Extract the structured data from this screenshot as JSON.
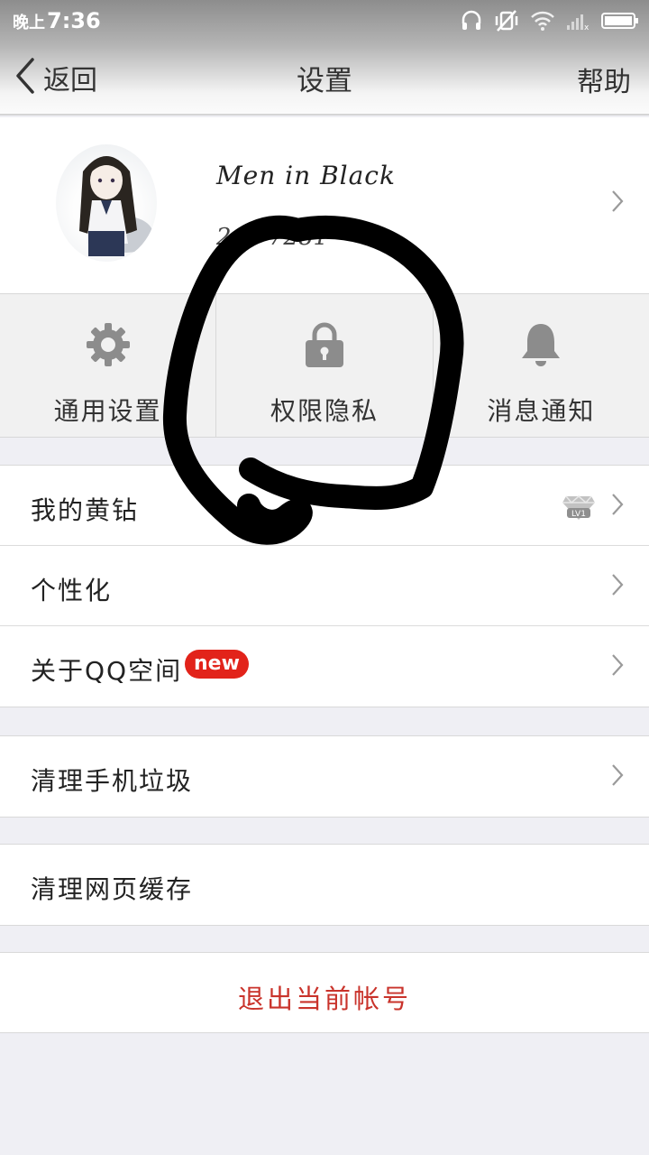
{
  "status_bar": {
    "period": "晚上",
    "time": "7:36",
    "icons": [
      "headset-icon",
      "vibrate-mute-icon",
      "wifi-icon",
      "signal-icon",
      "battery-icon"
    ]
  },
  "nav": {
    "back_label": "返回",
    "title": "设置",
    "help_label": "帮助"
  },
  "profile": {
    "name": "Men in Black",
    "number": "248  7281"
  },
  "quick_settings": [
    {
      "label": "通用设置",
      "icon": "gear-icon"
    },
    {
      "label": "权限隐私",
      "icon": "lock-icon"
    },
    {
      "label": "消息通知",
      "icon": "bell-icon"
    }
  ],
  "menu_group_1": [
    {
      "label": "我的黄钻",
      "badge": "LV1"
    },
    {
      "label": "个性化"
    },
    {
      "label": "关于QQ空间",
      "badge": "new"
    }
  ],
  "menu_group_2": [
    {
      "label": "清理手机垃圾"
    }
  ],
  "menu_group_3": [
    {
      "label": "清理网页缓存"
    }
  ],
  "logout_label": "退出当前帐号",
  "colors": {
    "accent_red": "#e2231a",
    "logout_text": "#c9332b",
    "icon_gray": "#8c8c8c"
  }
}
